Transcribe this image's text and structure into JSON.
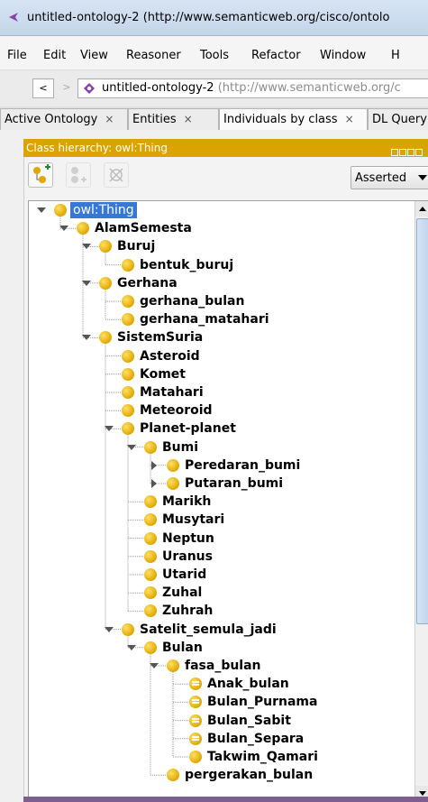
{
  "window": {
    "title": "untitled-ontology-2 (http://www.semanticweb.org/cisco/ontolo",
    "app_icon": "protege-icon"
  },
  "menu": [
    "File",
    "Edit",
    "View",
    "Reasoner",
    "Tools",
    "Refactor",
    "Window",
    "H"
  ],
  "address": {
    "back_glyph": "<",
    "forward_glyph": ">",
    "ontology_name": "untitled-ontology-2",
    "ontology_iri": " (http://www.semanticweb.org/c"
  },
  "tabs": [
    {
      "label": "Active Ontology",
      "close": "×"
    },
    {
      "label": "Entities",
      "close": "×"
    },
    {
      "label": "Individuals by class",
      "close": "×"
    },
    {
      "label": "DL Query",
      "close": ""
    }
  ],
  "panel": {
    "title": "Class hierarchy: owl:Thing",
    "mode": "Asserted",
    "tools": [
      "add-subclass-icon",
      "add-sibling-class-icon",
      "delete-class-icon"
    ]
  },
  "tree": [
    {
      "label": "owl:Thing",
      "depth": 0,
      "toggle": "open",
      "root": true
    },
    {
      "label": "AlamSemesta",
      "depth": 1,
      "toggle": "open"
    },
    {
      "label": "Buruj",
      "depth": 2,
      "toggle": "open"
    },
    {
      "label": "bentuk_buruj",
      "depth": 3,
      "toggle": ""
    },
    {
      "label": "Gerhana",
      "depth": 2,
      "toggle": "open"
    },
    {
      "label": "gerhana_bulan",
      "depth": 3,
      "toggle": ""
    },
    {
      "label": "gerhana_matahari",
      "depth": 3,
      "toggle": ""
    },
    {
      "label": "SistemSuria",
      "depth": 2,
      "toggle": "open"
    },
    {
      "label": "Asteroid",
      "depth": 3,
      "toggle": ""
    },
    {
      "label": "Komet",
      "depth": 3,
      "toggle": ""
    },
    {
      "label": "Matahari",
      "depth": 3,
      "toggle": ""
    },
    {
      "label": "Meteoroid",
      "depth": 3,
      "toggle": ""
    },
    {
      "label": "Planet-planet",
      "depth": 3,
      "toggle": "open"
    },
    {
      "label": "Bumi",
      "depth": 4,
      "toggle": "open"
    },
    {
      "label": "Peredaran_bumi",
      "depth": 5,
      "toggle": "closed"
    },
    {
      "label": "Putaran_bumi",
      "depth": 5,
      "toggle": "closed"
    },
    {
      "label": "Marikh",
      "depth": 4,
      "toggle": ""
    },
    {
      "label": "Musytari",
      "depth": 4,
      "toggle": ""
    },
    {
      "label": "Neptun",
      "depth": 4,
      "toggle": ""
    },
    {
      "label": "Uranus",
      "depth": 4,
      "toggle": ""
    },
    {
      "label": "Utarid",
      "depth": 4,
      "toggle": ""
    },
    {
      "label": "Zuhal",
      "depth": 4,
      "toggle": ""
    },
    {
      "label": "Zuhrah",
      "depth": 4,
      "toggle": ""
    },
    {
      "label": "Satelit_semula_jadi",
      "depth": 3,
      "toggle": "open"
    },
    {
      "label": "Bulan",
      "depth": 4,
      "toggle": "open"
    },
    {
      "label": "fasa_bulan",
      "depth": 5,
      "toggle": "open"
    },
    {
      "label": "Anak_bulan",
      "depth": 6,
      "toggle": "",
      "individual": true
    },
    {
      "label": "Bulan_Purnama",
      "depth": 6,
      "toggle": "",
      "individual": true
    },
    {
      "label": "Bulan_Sabit",
      "depth": 6,
      "toggle": "",
      "individual": true
    },
    {
      "label": "Bulan_Separa",
      "depth": 6,
      "toggle": "",
      "individual": true
    },
    {
      "label": "Takwim_Qamari",
      "depth": 6,
      "toggle": ""
    },
    {
      "label": "pergerakan_bulan",
      "depth": 5,
      "toggle": ""
    }
  ]
}
